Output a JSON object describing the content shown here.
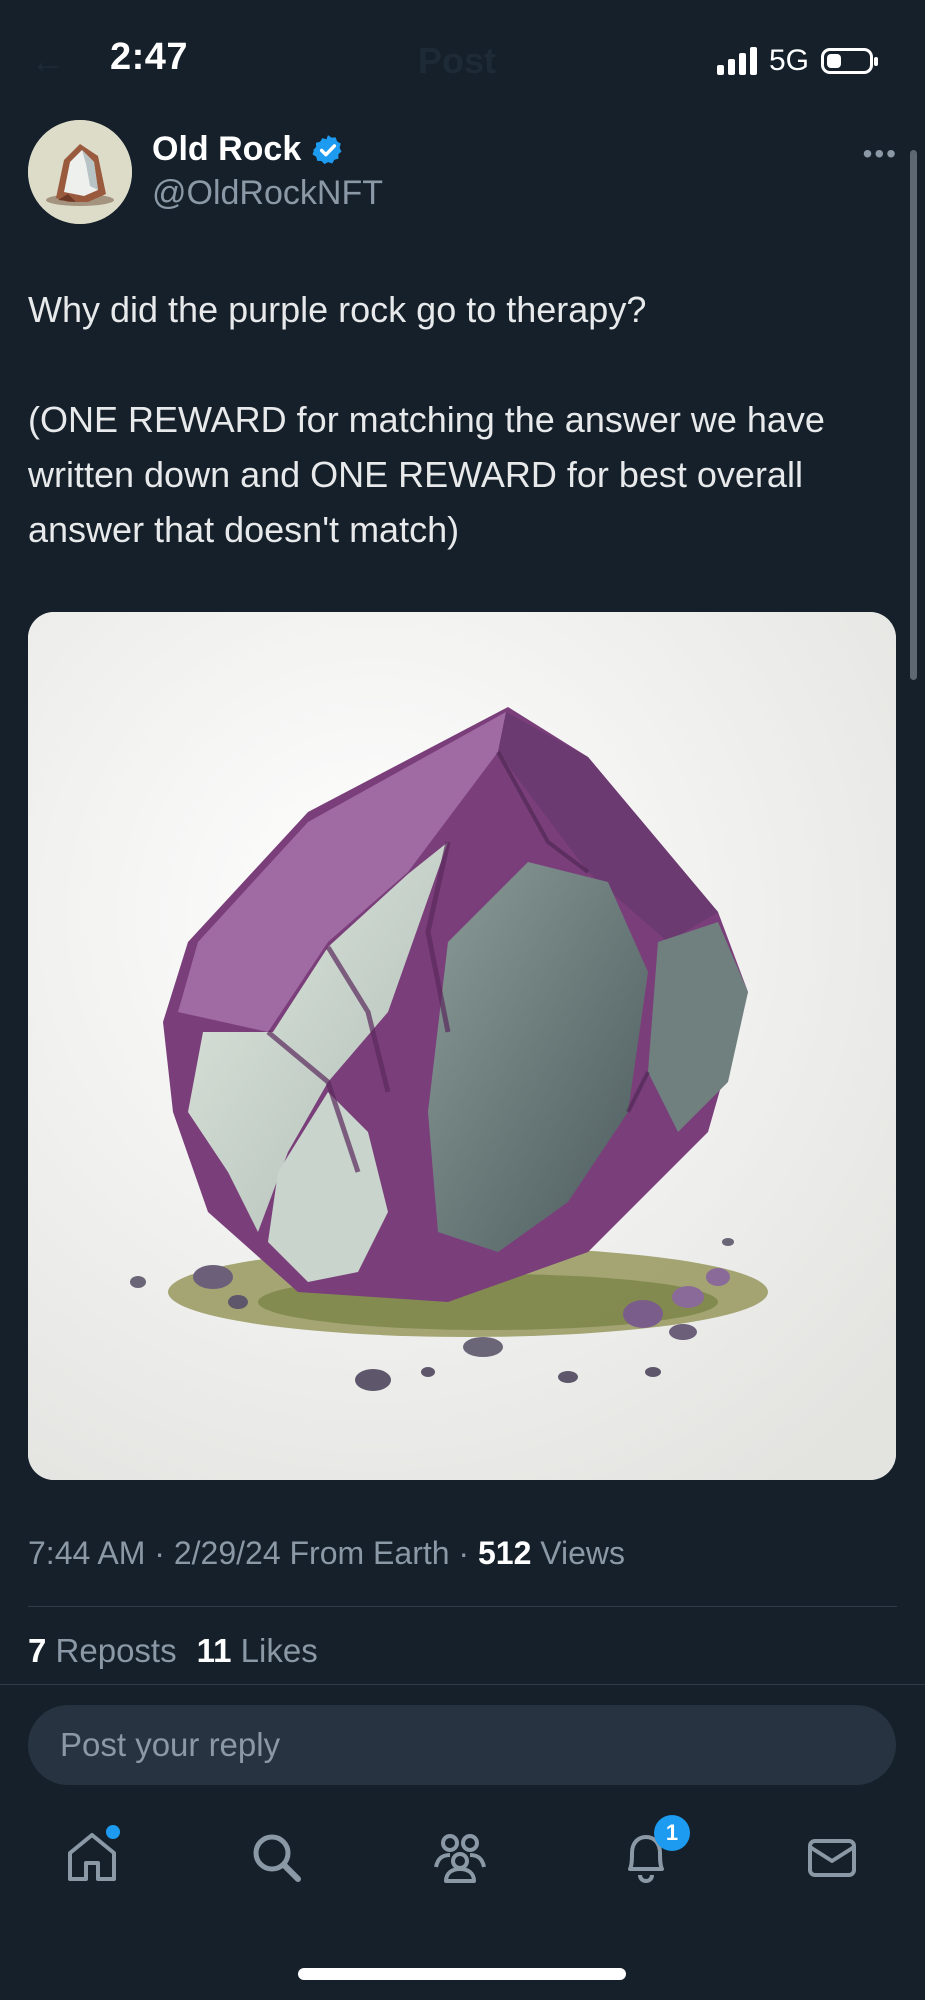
{
  "status_bar": {
    "time": "2:47",
    "network": "5G",
    "battery_percent": 25
  },
  "nav": {
    "title": "Post"
  },
  "author": {
    "name": "Old Rock",
    "handle": "@OldRockNFT",
    "verified": true
  },
  "tweet": {
    "line1": "Why did the purple rock go to therapy?",
    "line2": "(ONE REWARD for matching the answer we have written down and ONE REWARD for best overall answer that doesn't match)"
  },
  "media": {
    "description_icon": "purple-rock-illustration"
  },
  "meta": {
    "time": "7:44 AM",
    "date": "2/29/24",
    "source": "From Earth",
    "views_count": "512",
    "views_label": "Views"
  },
  "engagement": {
    "reposts_count": "7",
    "reposts_label": "Reposts",
    "likes_count": "11",
    "likes_label": "Likes"
  },
  "reply": {
    "placeholder": "Post your reply"
  },
  "tabbar": {
    "notifications_badge": "1"
  },
  "colors": {
    "background": "#15202b",
    "accent": "#1d9bf0",
    "muted": "#8b98a5"
  }
}
